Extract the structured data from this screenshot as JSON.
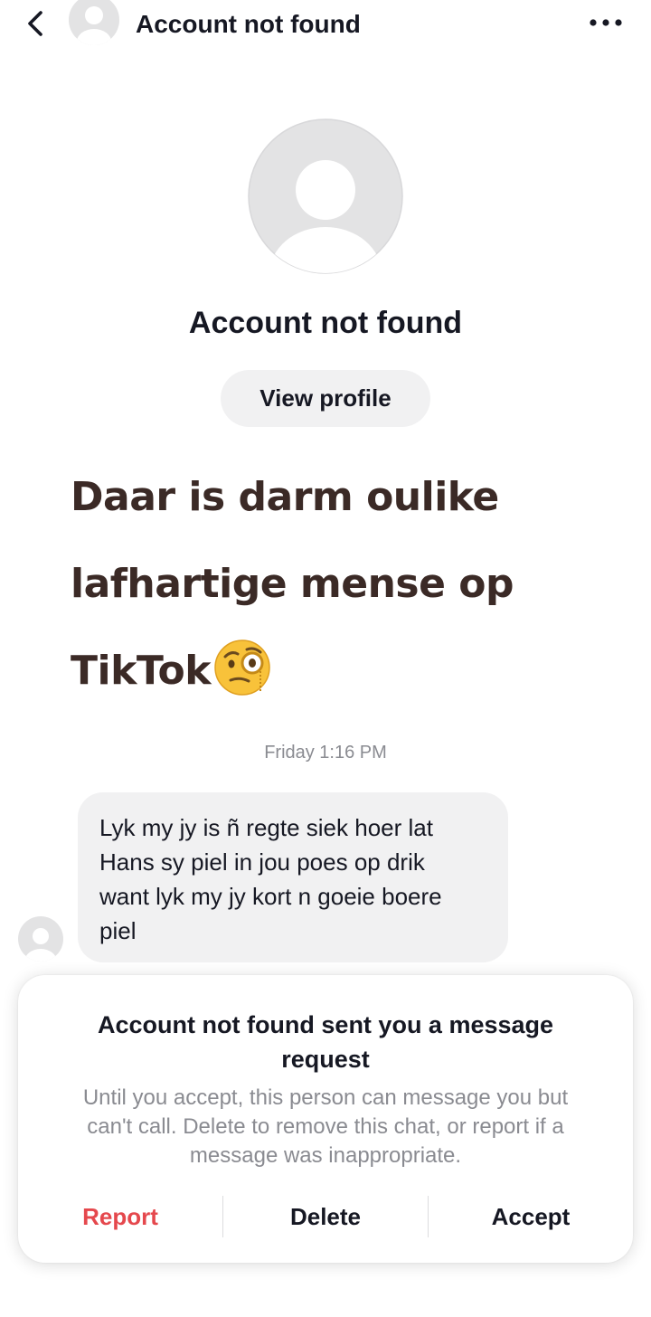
{
  "header": {
    "back_icon": "chevron-left-icon",
    "title": "Account not found",
    "more_icon": "more-horizontal-icon"
  },
  "profile": {
    "name": "Account not found",
    "view_profile_label": "View profile"
  },
  "overlay_caption": {
    "line1": "Daar is darm oulike",
    "line2": "lafhartige mense op",
    "line3": "TikTok",
    "emoji": "face-with-monocle",
    "color": "#3b2a26"
  },
  "chat": {
    "timestamp": "Friday 1:16 PM",
    "messages": [
      {
        "line1": "Lyk my jy is ñ regte siek hoer lat",
        "line2": "Hans sy piel in jou poes op drik",
        "line3": "want lyk my jy kort n goeie boere",
        "line4": "piel"
      }
    ]
  },
  "request": {
    "title_line1": "Account not found sent you a message",
    "title_line2": "request",
    "desc_line1": "Until you accept, this person can message you but",
    "desc_line2": "can't call. Delete to remove this chat, or report if a",
    "desc_line3": "message was inappropriate.",
    "report_label": "Report",
    "delete_label": "Delete",
    "accept_label": "Accept"
  },
  "colors": {
    "report": "#e5484d",
    "bubble": "#f1f1f2",
    "muted_text": "#8a8b91",
    "primary_text": "#161823"
  }
}
